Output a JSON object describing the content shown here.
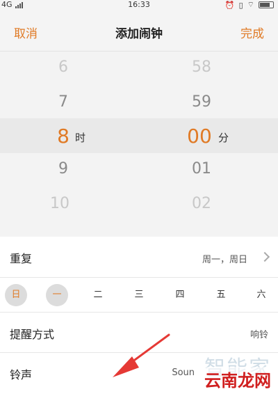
{
  "status": {
    "network": "4G",
    "time": "16:33"
  },
  "nav": {
    "cancel": "取消",
    "title": "添加闹钟",
    "done": "完成"
  },
  "picker": {
    "hours": [
      "6",
      "7",
      "8",
      "9",
      "10"
    ],
    "minutes": [
      "58",
      "59",
      "00",
      "01",
      "02"
    ],
    "hour_unit": "时",
    "minute_unit": "分"
  },
  "repeat": {
    "label": "重复",
    "value": "周一，周日"
  },
  "days": [
    "日",
    "一",
    "二",
    "三",
    "四",
    "五",
    "六"
  ],
  "reminder": {
    "label": "提醒方式",
    "value": "响铃"
  },
  "ringtone": {
    "label": "铃声",
    "value": "Soun"
  },
  "watermark": {
    "top": "智能家",
    "bottom": "云南龙网"
  },
  "colors": {
    "accent": "#e07a25",
    "arrow": "#e53935"
  }
}
